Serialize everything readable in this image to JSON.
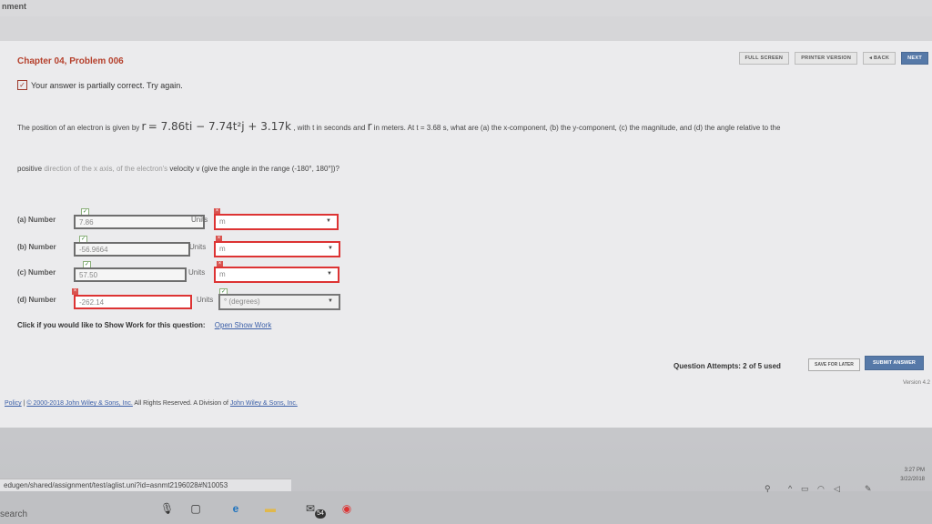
{
  "window": {
    "title_fragment": "nment"
  },
  "toolbar": {
    "fullscreen_label": "FULL SCREEN",
    "printer_label": "PRINTER VERSION",
    "back_label": "◂ BACK",
    "next_label": "NEXT"
  },
  "problem": {
    "title": "Chapter 04, Problem 006",
    "status": "Your answer is partially correct.  Try again.",
    "text_part1": "The position of an electron is given by",
    "r_symbol": "r",
    "equation": "= 7.86ti − 7.74t²j + 3.17k",
    "text_part2": ", with t in seconds and",
    "text_part3": "in meters. At t = 3.68 s, what are (a) the x-component, (b) the y-component, (c) the magnitude, and (d) the angle relative to the",
    "text_line2_start": "positive",
    "text_line2_faint": " direction of the x axis, of the electron's",
    "text_line2_end": " velocity",
    "v_symbol": "v",
    "text_line2_tail": "(give the angle in the range (-180°, 180°])?"
  },
  "answers": [
    {
      "label": "(a) Number",
      "value": "7.86",
      "units_label": "Units",
      "unit": "m"
    },
    {
      "label": "(b) Number",
      "value": "-56.9664",
      "units_label": "Units",
      "unit": "m"
    },
    {
      "label": "(c) Number",
      "value": "57.50",
      "units_label": "Units",
      "unit": "m"
    },
    {
      "label": "(d) Number",
      "value": "-262.14",
      "units_label": "Units",
      "unit": "° (degrees)"
    }
  ],
  "showwork": {
    "prompt": "Click if you would like to Show Work for this question:",
    "link": "Open Show Work"
  },
  "submission": {
    "attempts": "Question Attempts: 2 of 5 used",
    "save_label": "SAVE FOR LATER",
    "submit_label": "SUBMIT ANSWER",
    "version": "Version 4.2"
  },
  "footer": {
    "policy": "Policy",
    "sep": " | ",
    "copyright_link": "© 2000-2018 John Wiley & Sons, Inc.",
    "rights": " All Rights Reserved. A Division of ",
    "division_link": "John Wiley & Sons, Inc."
  },
  "statusbar": {
    "url": "edugen/shared/assignment/test/aglist.uni?id=asnmt2196028#N10053"
  },
  "taskbar": {
    "search_label": "search",
    "badge": "54",
    "time": "3:27 PM",
    "date": "3/22/2018"
  }
}
